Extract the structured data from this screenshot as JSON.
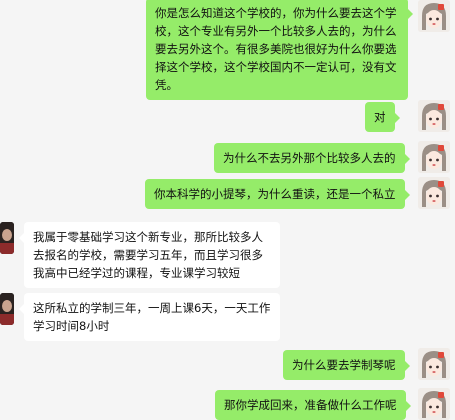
{
  "messages": [
    {
      "side": "me",
      "text": "你是怎么知道这个学校的，你为什么要去这个学校，这个专业有另外一个比较多人去的，为什么要去另外这个。有很多美院也很好为什么你要选择这个学校，这个学校国内不一定认可，没有文凭。"
    },
    {
      "side": "me",
      "text": "对"
    },
    {
      "side": "me",
      "text": "为什么不去另外那个比较多人去的"
    },
    {
      "side": "me",
      "text": "你本科学的小提琴，为什么重读，还是一个私立"
    },
    {
      "side": "them",
      "text": "我属于零基础学习这个新专业，那所比较多人去报名的学校，需要学习五年，而且学习很多我高中已经学过的课程，专业课学习较短"
    },
    {
      "side": "them",
      "text": "这所私立的学制三年，一周上课6天，一天工作学习时间8小时"
    },
    {
      "side": "me",
      "text": "为什么要去学制琴呢"
    },
    {
      "side": "me",
      "text": "那你学成回来，准备做什么工作呢"
    }
  ],
  "colors": {
    "background": "#f5f5f5",
    "outgoing_bubble": "#95ec69",
    "incoming_bubble": "#ffffff"
  }
}
